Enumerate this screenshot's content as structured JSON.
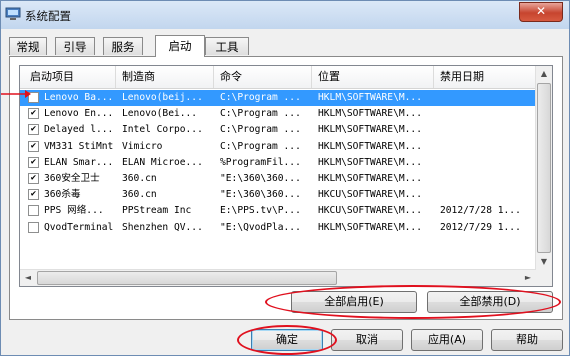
{
  "window": {
    "title": "系统配置",
    "close_glyph": "✕"
  },
  "tabs": [
    {
      "label": "常规"
    },
    {
      "label": "引导"
    },
    {
      "label": "服务"
    },
    {
      "label": "启动"
    },
    {
      "label": "工具"
    }
  ],
  "active_tab": "启动",
  "columns": [
    "启动项目",
    "制造商",
    "命令",
    "位置",
    "禁用日期"
  ],
  "rows": [
    {
      "checked": false,
      "item": "Lenovo Ba...",
      "maker": "Lenovo(beij...",
      "command": "C:\\Program ...",
      "location": "HKLM\\SOFTWARE\\M...",
      "date": "",
      "selected": true
    },
    {
      "checked": true,
      "item": "Lenovo En...",
      "maker": "Lenovo(Bei...",
      "command": "C:\\Program ...",
      "location": "HKLM\\SOFTWARE\\M...",
      "date": ""
    },
    {
      "checked": true,
      "item": "Delayed l...",
      "maker": "Intel Corpo...",
      "command": "C:\\Program ...",
      "location": "HKLM\\SOFTWARE\\M...",
      "date": ""
    },
    {
      "checked": true,
      "item": "VM331 StiMnt",
      "maker": "Vimicro",
      "command": "C:\\Program ...",
      "location": "HKLM\\SOFTWARE\\M...",
      "date": ""
    },
    {
      "checked": true,
      "item": "ELAN Smar...",
      "maker": "ELAN Microe...",
      "command": "%ProgramFil...",
      "location": "HKLM\\SOFTWARE\\M...",
      "date": ""
    },
    {
      "checked": true,
      "item": "360安全卫士",
      "maker": "360.cn",
      "command": "\"E:\\360\\360...",
      "location": "HKLM\\SOFTWARE\\M...",
      "date": ""
    },
    {
      "checked": true,
      "item": "360杀毒",
      "maker": "360.cn",
      "command": "\"E:\\360\\360...",
      "location": "HKCU\\SOFTWARE\\M...",
      "date": ""
    },
    {
      "checked": false,
      "item": "PPS 网络...",
      "maker": "PPStream Inc",
      "command": "E:\\PPS.tv\\P...",
      "location": "HKCU\\SOFTWARE\\M...",
      "date": "2012/7/28 1..."
    },
    {
      "checked": false,
      "item": "QvodTerminal",
      "maker": "Shenzhen QV...",
      "command": "\"E:\\QvodPla...",
      "location": "HKLM\\SOFTWARE\\M...",
      "date": "2012/7/29 1..."
    }
  ],
  "buttons": {
    "enable_all": "全部启用(E)",
    "disable_all": "全部禁用(D)",
    "ok": "确定",
    "cancel": "取消",
    "apply": "应用(A)",
    "help": "帮助"
  },
  "scroll": {
    "up": "▲",
    "down": "▼",
    "left": "◄",
    "right": "►"
  },
  "annotation_color": "#e0101e"
}
